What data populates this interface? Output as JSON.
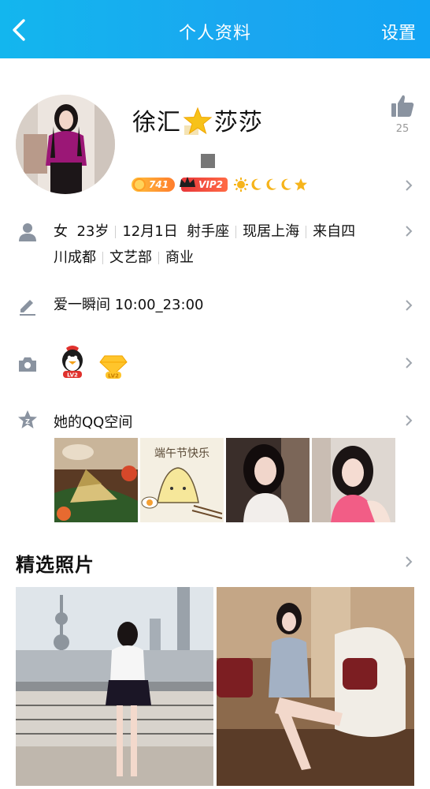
{
  "header": {
    "title": "个人资料",
    "settings_label": "设置"
  },
  "profile": {
    "name_part1": "徐汇",
    "name_part2": "莎莎",
    "like_count": "25",
    "coin_badge": "741",
    "vip_badge": "VIP2"
  },
  "info": {
    "gender": "女",
    "age": "23岁",
    "birthday": "12月1日",
    "zodiac": "射手座",
    "residence": "现居上海",
    "hometown_line1": "来自四",
    "hometown_line2": "川成都",
    "department": "文艺部",
    "industry": "商业"
  },
  "signature": {
    "text": "爱一瞬间 10:00_23:00"
  },
  "qzone": {
    "label": "她的QQ空间",
    "thumbnails": [
      {
        "name": "zongzi-photo"
      },
      {
        "name": "dragon-boat-card",
        "caption": "端午节快乐"
      },
      {
        "name": "selfie-1"
      },
      {
        "name": "selfie-2"
      }
    ]
  },
  "featured": {
    "title": "精选照片"
  },
  "colors": {
    "header_start": "#13b6ee",
    "header_end": "#12a4f3",
    "icon_grey": "#8a93a0"
  }
}
